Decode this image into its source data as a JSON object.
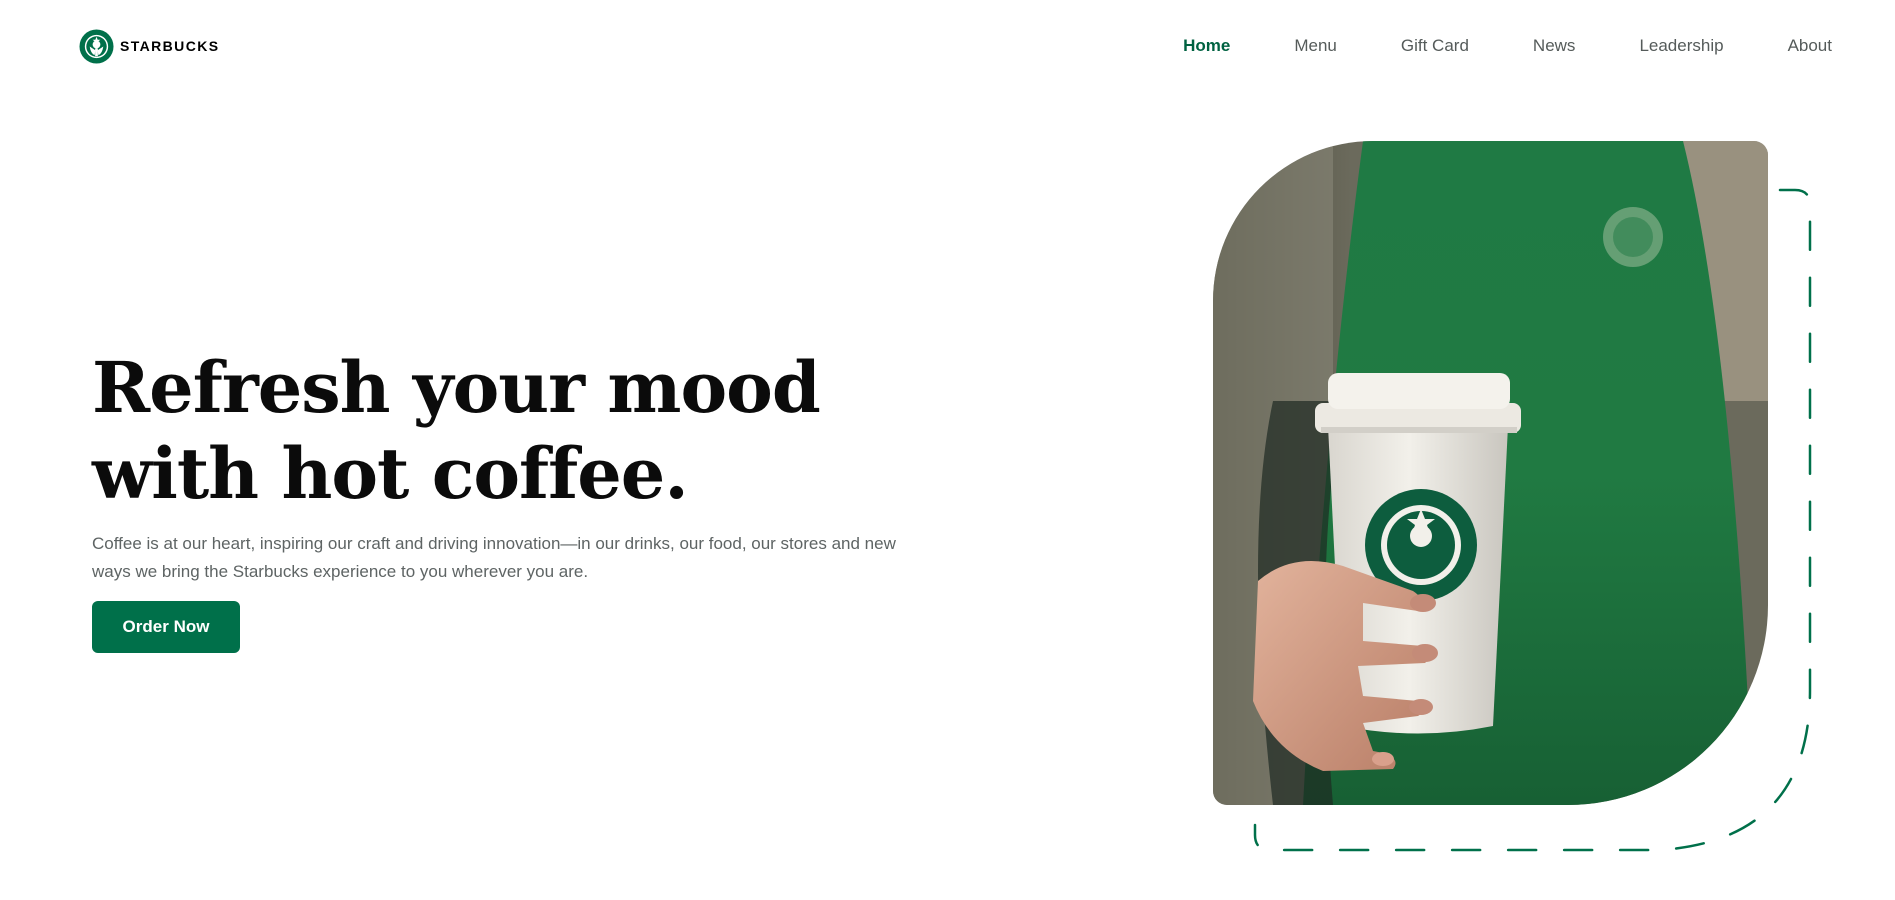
{
  "brand": {
    "name": "STARBUCKS",
    "logo_icon": "starbucks-siren-logo",
    "color": "#00704a"
  },
  "nav": {
    "items": [
      {
        "label": "Home",
        "active": true
      },
      {
        "label": "Menu",
        "active": false
      },
      {
        "label": "Gift Card",
        "active": false
      },
      {
        "label": "News",
        "active": false
      },
      {
        "label": "Leadership",
        "active": false
      },
      {
        "label": "About",
        "active": false
      }
    ],
    "active_color": "#006241"
  },
  "hero": {
    "title": "Refresh your mood with hot coffee.",
    "description": "Coffee is at our heart, inspiring our craft and driving innovation—in our drinks, our food, our stores and new ways we bring the Starbucks experience to you wherever you are.",
    "cta_label": "Order Now",
    "image_subject": "hand-holding-starbucks-cup-photo"
  }
}
